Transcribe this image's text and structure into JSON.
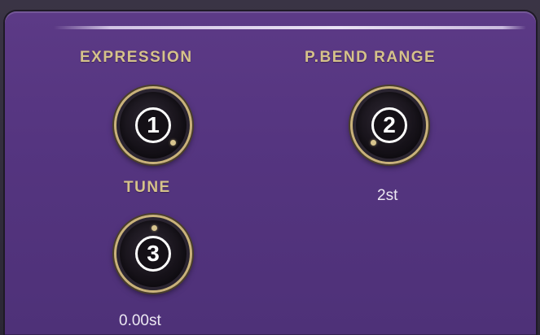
{
  "controls": {
    "expression": {
      "label": "EXPRESSION",
      "badge": "1"
    },
    "pbend_range": {
      "label": "P.BEND RANGE",
      "badge": "2",
      "value": "2st"
    },
    "tune": {
      "label": "TUNE",
      "badge": "3",
      "value": "0.00st"
    }
  },
  "colors": {
    "panel": "#553580",
    "label": "#d6c28a",
    "value": "#ece8f2",
    "knob_ring": "#c9b27a"
  }
}
